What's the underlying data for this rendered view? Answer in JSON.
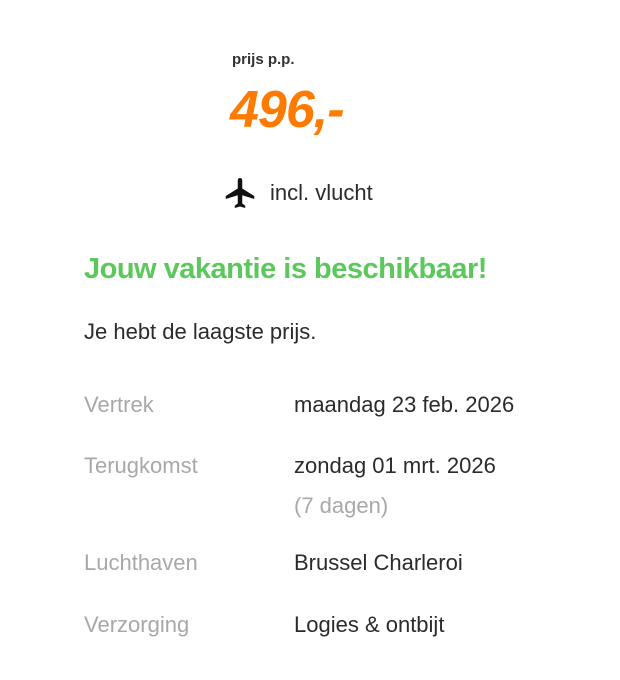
{
  "price": {
    "label": "prijs p.p.",
    "amount": "496,-"
  },
  "flight": {
    "icon": "airplane-icon",
    "text": "incl. vlucht"
  },
  "availability": {
    "heading": "Jouw vakantie is beschikbaar!",
    "subtext": "Je hebt de laagste prijs."
  },
  "details": [
    {
      "label": "Vertrek",
      "value": "maandag 23 feb. 2026"
    },
    {
      "label": "Terugkomst",
      "value": "zondag 01 mrt. 2026",
      "sub": "(7 dagen)"
    },
    {
      "label": "Luchthaven",
      "value": "Brussel Charleroi"
    },
    {
      "label": "Verzorging",
      "value": "Logies & ontbijt"
    }
  ],
  "colors": {
    "price": "#ff7a00",
    "heading": "#5cc85c",
    "label": "#a8a8a8",
    "text": "#2b2b2b"
  }
}
